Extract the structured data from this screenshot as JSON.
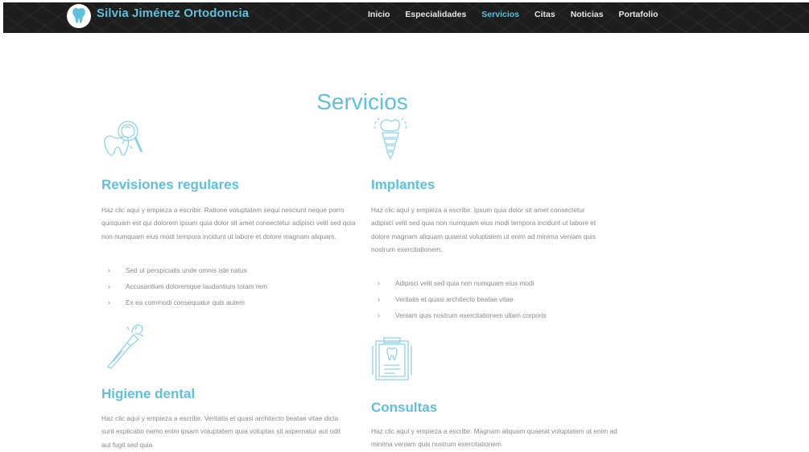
{
  "brand": "Silvia Jiménez Ortodoncia",
  "nav": [
    {
      "label": "Inicio"
    },
    {
      "label": "Especialidades"
    },
    {
      "label": "Servicios"
    },
    {
      "label": "Citas"
    },
    {
      "label": "Noticias"
    },
    {
      "label": "Portafolio"
    }
  ],
  "active_nav": "Servicios",
  "section_title": "Servicios",
  "services": {
    "revisiones": {
      "title": "Revisiones regulares",
      "icon": "tooth-magnifier-icon",
      "text": "Haz clic aquí y empieza a escribir. Ratione voluptatem sequi nesciunt neque porro quisquam est qui dolorem ipsum quia dolor sit amet consectetur adipisci velit sed quia non numquam eius modi tempora incidunt ut labore et dolore magnam aliquam.",
      "items": [
        "Sed ut perspiciatis unde omnis iste natus",
        "Accusantium doloremque laudantium totam rem",
        "Ex ea commodi consequatur quis autem"
      ]
    },
    "implantes": {
      "title": "Implantes",
      "icon": "dental-implant-icon",
      "text": "Haz clic aquí y empieza a escribir. Ipsum quia dolor sit amet consectetur adipisci velit sed quia non numquam eius modi tempora incidunt ut labore et dolore magnam aliquam quaerat voluptatem ut enim ad minima veniam quis nostrum exercitationem.",
      "items": [
        "Adipisci velit sed quia non numquam eius modi",
        "Veritatis et quasi architecto beatae vitae",
        "Veniam quis nostrum exercitationem ullam corporis"
      ]
    },
    "higiene": {
      "title": "Higiene dental",
      "icon": "toothbrush-icon",
      "text": "Haz clic aquí y empieza a escribir. Veritatis et quasi architecto beatae vitae dicta sunt explicabo nemo enim ipsam voluptatem quia voluptas sit aspernatur aut odit aut fugit sed quia"
    },
    "consultas": {
      "title": "Consultas",
      "icon": "dental-record-icon",
      "text": "Haz clic aquí y empieza a escribir. Magnam aliquam quaerat voluptatem ut enim ad minima veniam quis nostrum exercitationem"
    }
  },
  "colors": {
    "accent": "#5ec0dc",
    "nav_bg": "#1d1d1d",
    "body_text": "#8a8a8a"
  }
}
